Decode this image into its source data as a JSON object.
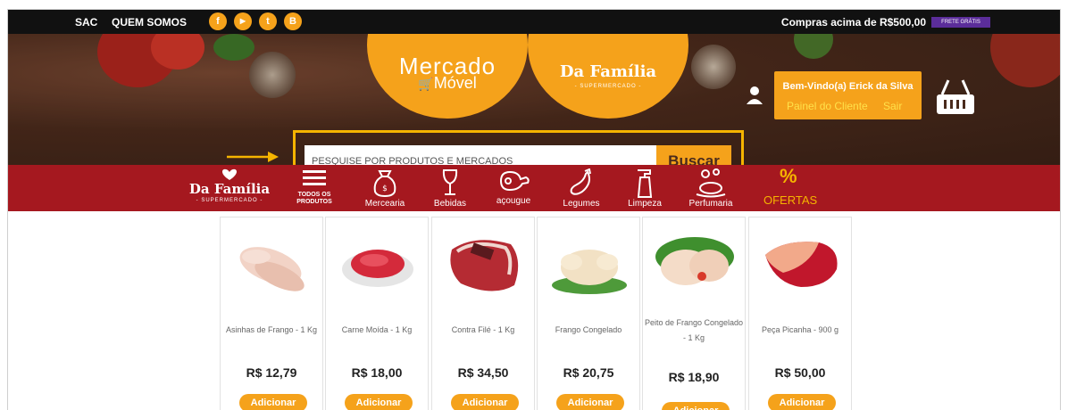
{
  "topbar": {
    "sac": "SAC",
    "quem_somos": "QUEM SOMOS",
    "social": [
      {
        "icon": "facebook-icon",
        "glyph": "f"
      },
      {
        "icon": "youtube-icon",
        "glyph": "▶"
      },
      {
        "icon": "twitter-icon",
        "glyph": "t"
      },
      {
        "icon": "blogger-icon",
        "glyph": "B"
      }
    ],
    "promo": "Compras acima de R$500,00",
    "badge": "FRETE GRÁTIS"
  },
  "header": {
    "mercado_movel_1": "Mercado",
    "mercado_movel_2": "Móvel",
    "brand_name": "Da Família",
    "brand_sub": "- SUPERMERCADO -",
    "welcome": "Bem-Vindo(a) Erick da Silva",
    "painel": "Painel do Cliente",
    "sair": "Sair"
  },
  "search": {
    "placeholder": "PESQUISE POR PRODUTOS E MERCADOS",
    "button": "Buscar"
  },
  "nav": {
    "brand_name": "Da Família",
    "brand_sub": "- SUPERMERCADO -",
    "todos_1": "TODOS OS",
    "todos_2": "PRODUTOS",
    "mercearia": "Mercearia",
    "bebidas": "Bebidas",
    "acougue": "açougue",
    "legumes": "Legumes",
    "limpeza": "Limpeza",
    "perfumaria": "Perfumaria",
    "ofertas_icon": "%",
    "ofertas": "OFERTAS"
  },
  "products": [
    {
      "name": "Asinhas de Frango - 1 Kg",
      "price": "R$ 12,79",
      "button": "Adicionar"
    },
    {
      "name": "Carne Moída - 1 Kg",
      "price": "R$ 18,00",
      "button": "Adicionar"
    },
    {
      "name": "Contra Filé - 1 Kg",
      "price": "R$ 34,50",
      "button": "Adicionar"
    },
    {
      "name": "Frango Congelado",
      "price": "R$ 20,75",
      "button": "Adicionar"
    },
    {
      "name": "Peito de Frango Congelado - 1 Kg",
      "price": "R$ 18,90",
      "button": "Adicionar"
    },
    {
      "name": "Peça Picanha - 900 g",
      "price": "R$ 50,00",
      "button": "Adicionar"
    }
  ],
  "colors": {
    "accent": "#f5a21b",
    "nav": "#a5181f",
    "highlight": "#f5b400",
    "topbar": "#111111",
    "badge": "#5b2d9a"
  }
}
